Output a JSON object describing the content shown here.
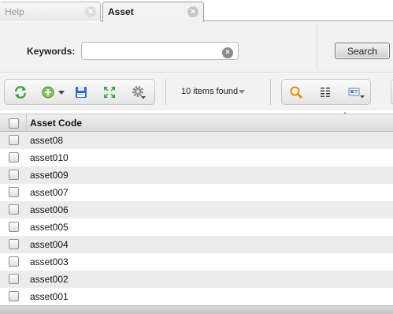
{
  "tabs": [
    {
      "label": "Help",
      "active": false
    },
    {
      "label": "Asset",
      "active": true
    }
  ],
  "search": {
    "keywords_label": "Keywords:",
    "keywords_value": "",
    "keywords_placeholder": "",
    "search_button": "Search"
  },
  "toolbar": {
    "items_found": "10 items found",
    "icons": [
      "refresh-icon",
      "add-icon",
      "save-icon",
      "expand-icon",
      "gear-icon",
      "search-icon",
      "columns-icon",
      "card-view-icon"
    ]
  },
  "grid": {
    "column_header": "Asset Code",
    "rows": [
      {
        "code": "asset08"
      },
      {
        "code": "asset010"
      },
      {
        "code": "asset009"
      },
      {
        "code": "asset007"
      },
      {
        "code": "asset006"
      },
      {
        "code": "asset005"
      },
      {
        "code": "asset004"
      },
      {
        "code": "asset003"
      },
      {
        "code": "asset002"
      },
      {
        "code": "asset001"
      }
    ]
  },
  "colors": {
    "accent": "#1a9fae",
    "green_icon": "#3aa23a",
    "save_blue": "#2f6fc2",
    "magnifier_orange": "#e08a1e"
  }
}
